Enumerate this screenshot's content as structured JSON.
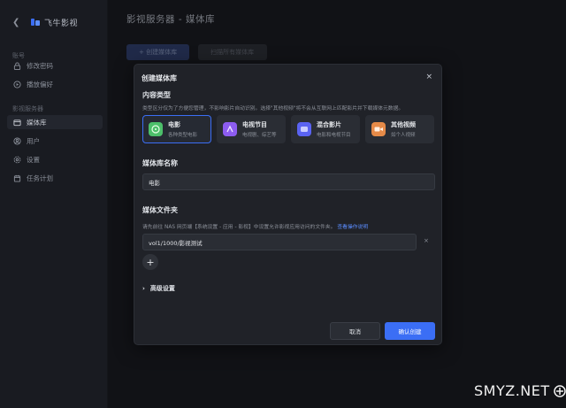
{
  "app": {
    "name": "飞牛影视"
  },
  "sidebar": {
    "groups": [
      {
        "label": "账号"
      },
      {
        "label": "影视服务器"
      }
    ],
    "items": [
      {
        "label": "修改密码",
        "icon": "lock-icon"
      },
      {
        "label": "播放偏好",
        "icon": "play-circle-icon"
      },
      {
        "label": "媒体库",
        "icon": "media-library-icon",
        "active": true
      },
      {
        "label": "用户",
        "icon": "user-icon"
      },
      {
        "label": "设置",
        "icon": "gear-icon"
      },
      {
        "label": "任务计划",
        "icon": "calendar-icon"
      }
    ]
  },
  "header": {
    "title": "影视服务器 - 媒体库"
  },
  "toolbar": {
    "create_label": "+ 创建媒体库",
    "scan_label": "扫描所有媒体库"
  },
  "modal": {
    "title": "创建媒体库",
    "close": "×",
    "content_type": {
      "title": "内容类型",
      "hint": "类型区分仅为了方便您管理，不影响影片自动识别。选择\"其他视频\"将不会从互联网上匹配影片并下载媒体元数据。",
      "options": [
        {
          "name": "电影",
          "desc": "各种类型电影",
          "selected": true,
          "color": "#4cbf6a"
        },
        {
          "name": "电视节目",
          "desc": "电视剧、综艺等",
          "selected": false,
          "color": "#8d5cf0"
        },
        {
          "name": "混合影片",
          "desc": "电影和电视节目",
          "selected": false,
          "color": "#5a63f2"
        },
        {
          "name": "其他视频",
          "desc": "如个人视频",
          "selected": false,
          "color": "#e58a48"
        }
      ]
    },
    "library_name": {
      "title": "媒体库名称",
      "value": "电影"
    },
    "folder": {
      "title": "媒体文件夹",
      "hint": "请先前往 NAS 网页端【系统设置 - 应用 - 影视】中设置允许影视应用访问的文件夹。",
      "link": "查看操作说明",
      "path": "vol1/1000/影视测试",
      "remove": "×",
      "add": "+"
    },
    "advanced": {
      "label": "高级设置"
    },
    "cancel_label": "取消",
    "confirm_label": "确认创建"
  },
  "watermark": {
    "text": "SMYZ.NET"
  }
}
